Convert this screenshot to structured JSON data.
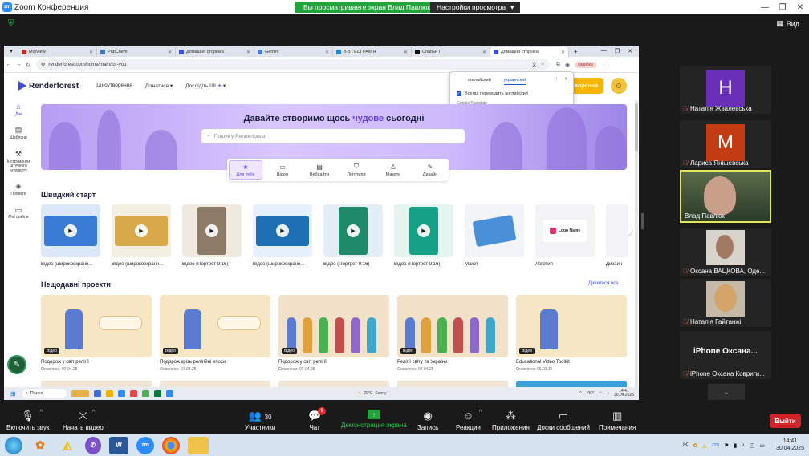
{
  "zoom": {
    "window_title": "Zoom Конференция",
    "share_banner": "Вы просматриваете экран Влад Павлюк",
    "view_settings": "Настройки просмотра",
    "view_label": "Вид"
  },
  "browser": {
    "tabs": [
      {
        "label": "MoiView",
        "icon": "moiview-icon"
      },
      {
        "label": "PubChem",
        "icon": "pubchem-icon"
      },
      {
        "label": "Домашня сторінка",
        "icon": "renderforest-icon"
      },
      {
        "label": "Gemini",
        "icon": "gemini-icon"
      },
      {
        "label": "8-В ГЕОГРАФІЯ",
        "icon": "classroom-icon"
      },
      {
        "label": "ChatGPT",
        "icon": "chatgpt-icon"
      },
      {
        "label": "Домашня сторінка",
        "icon": "renderforest-icon",
        "active": true
      }
    ],
    "url": "renderforest.com/home/main/for-you",
    "error_chip": "Ошибка"
  },
  "translate_popup": {
    "source_lang": "английский",
    "target_lang": "украинский",
    "always_translate": "Всегда переводить английский",
    "footer": "Google Translate"
  },
  "renderforest": {
    "logo": "Renderforest",
    "nav": [
      "Ціноутворення",
      "Дізнатися",
      "Дослідіть ШІ"
    ],
    "create_button": "ворення",
    "sidebar": [
      {
        "label": "Дім",
        "icon": "home-icon",
        "active": true
      },
      {
        "label": "Шаблони",
        "icon": "templates-icon"
      },
      {
        "label": "Інструменти штучного інтелекту",
        "icon": "ai-tools-icon"
      },
      {
        "label": "Проекти",
        "icon": "projects-icon"
      },
      {
        "label": "Мої файли",
        "icon": "folder-icon"
      }
    ],
    "hero": {
      "title_start": "Давайте створимо щось ",
      "title_accent": "чудове",
      "title_end": " сьогодні",
      "search_placeholder": "Пошук у Renderforest"
    },
    "categories": [
      {
        "label": "Для тебе",
        "icon": "star-icon",
        "active": true
      },
      {
        "label": "Відео",
        "icon": "video-icon"
      },
      {
        "label": "Вебсайти",
        "icon": "website-icon"
      },
      {
        "label": "Логотипи",
        "icon": "logo-icon"
      },
      {
        "label": "Макети",
        "icon": "mockup-icon"
      },
      {
        "label": "Дизайн",
        "icon": "design-icon"
      }
    ],
    "quick_start_title": "Швидкий старт",
    "quick_start": [
      {
        "label": "Відео (широкоекранн...",
        "color": "#dce7f7"
      },
      {
        "label": "Відео (широкоекранн...",
        "color": "#f4efe3"
      },
      {
        "label": "Відео (Портрет 9:16)",
        "color": "#efe9df"
      },
      {
        "label": "Відео (широкоекранн...",
        "color": "#e6f0fb"
      },
      {
        "label": "Відео (Портрет 9:16)",
        "color": "#e3eef6"
      },
      {
        "label": "Відео (Портрет 9:16)",
        "color": "#e4f4ee"
      },
      {
        "label": "Макет",
        "color": "#f3f4f8"
      },
      {
        "label": "Логотип",
        "color": "#f4f4f6"
      },
      {
        "label": "Дизайн",
        "color": "#f4f4f6"
      }
    ],
    "logo_card_text": "Logo Name",
    "recent_title": "Нещодавні проекти",
    "see_all": "Дивитися все",
    "recent": [
      {
        "name": "Подорож у світ релігії",
        "date": "Оновлено: 07.04.25",
        "color": "#f7e6c3"
      },
      {
        "name": "Подорож крізь релігійні епохи",
        "date": "Оновлено: 07.04.25",
        "color": "#f7e6c3"
      },
      {
        "name": "Подорож у світ релігії",
        "date": "Оновлено: 07.04.25",
        "color": "#f0e1c8"
      },
      {
        "name": "Релігії світу та України",
        "date": "Оновлено: 07.04.25",
        "color": "#f0e1c8"
      },
      {
        "name": "Educational Video Toolkit",
        "date": "Оновлено: 06.03.25",
        "color": "#f7e6c3"
      }
    ],
    "recent_chip": "Відео"
  },
  "inner_taskbar": {
    "search": "Поиск",
    "weather_temp": "20°C",
    "weather_desc": "Sunny",
    "lang": "УКР",
    "time": "14:41",
    "date": "30.04.2025"
  },
  "participants": [
    {
      "name": "Наталія Жвалевська",
      "letter": "Н",
      "color": "#6a2fb8",
      "muted": true
    },
    {
      "name": "Лариса Янішевська",
      "letter": "М",
      "color": "#c23b12",
      "muted": true
    },
    {
      "name": "Влад Павлюк",
      "active": true,
      "muted": false
    },
    {
      "name": "Оксана  ВАЦКОВА, Оде...",
      "muted": true
    },
    {
      "name": "Наталія Гайтанжі",
      "muted": true
    },
    {
      "name": "iPhone Оксана Ковриги...",
      "bigname": "iPhone  Оксана...",
      "muted": true
    }
  ],
  "toolbar": {
    "mute": "Включить звук",
    "video": "Начать видео",
    "participants": "Участники",
    "participants_count": "30",
    "chat": "Чат",
    "chat_badge": "9",
    "share": "Демонстрация экрана",
    "record": "Запись",
    "reactions": "Реакции",
    "apps": "Приложения",
    "whiteboard": "Доски сообщений",
    "notes": "Примечания",
    "leave": "Выйти"
  },
  "os_taskbar": {
    "lang": "UK",
    "time": "14:41",
    "date": "30.04.2025"
  }
}
